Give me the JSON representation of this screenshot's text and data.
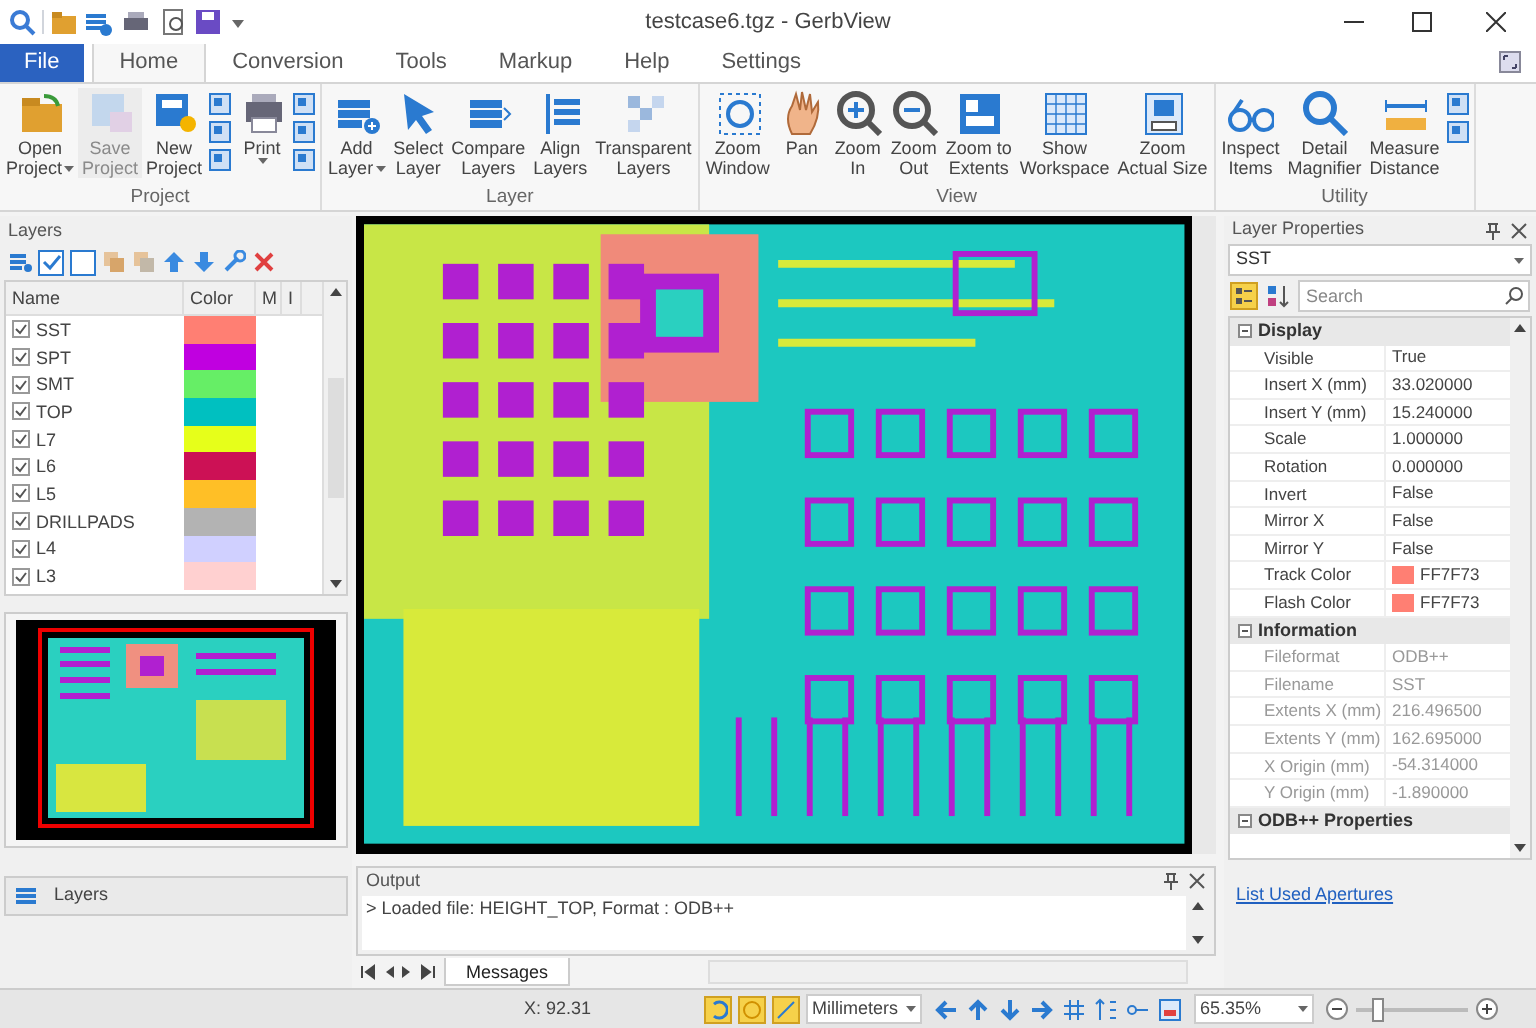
{
  "window": {
    "title": "testcase6.tgz - GerbView"
  },
  "ribbon": {
    "tabs": [
      {
        "label": "File",
        "kind": "file",
        "selected": false
      },
      {
        "label": "Home",
        "kind": "tab",
        "selected": true
      },
      {
        "label": "Conversion",
        "kind": "tab",
        "selected": false
      },
      {
        "label": "Tools",
        "kind": "tab",
        "selected": false
      },
      {
        "label": "Markup",
        "kind": "tab",
        "selected": false
      },
      {
        "label": "Help",
        "kind": "tab",
        "selected": false
      },
      {
        "label": "Settings",
        "kind": "tab",
        "selected": false
      }
    ],
    "groups": [
      {
        "label": "Project",
        "buttons": [
          {
            "lines": [
              "Open",
              "Project"
            ],
            "dropdown": true,
            "disabled": false
          },
          {
            "lines": [
              "Save",
              "Project"
            ],
            "dropdown": false,
            "disabled": true
          },
          {
            "lines": [
              "New",
              "Project"
            ],
            "dropdown": false,
            "disabled": false
          },
          {
            "lines": [
              "Print"
            ],
            "dropdown": true,
            "disabled": false
          }
        ]
      },
      {
        "label": "Layer",
        "buttons": [
          {
            "lines": [
              "Add",
              "Layer"
            ],
            "dropdown": true,
            "disabled": false
          },
          {
            "lines": [
              "Select",
              "Layer"
            ],
            "dropdown": false,
            "disabled": false
          },
          {
            "lines": [
              "Compare",
              "Layers"
            ],
            "dropdown": false,
            "disabled": false
          },
          {
            "lines": [
              "Align",
              "Layers"
            ],
            "dropdown": false,
            "disabled": false
          },
          {
            "lines": [
              "Transparent",
              "Layers"
            ],
            "dropdown": false,
            "disabled": false
          }
        ]
      },
      {
        "label": "View",
        "buttons": [
          {
            "lines": [
              "Zoom",
              "Window"
            ],
            "dropdown": false,
            "disabled": false
          },
          {
            "lines": [
              "Pan"
            ],
            "dropdown": false,
            "disabled": false
          },
          {
            "lines": [
              "Zoom",
              "In"
            ],
            "dropdown": false,
            "disabled": false
          },
          {
            "lines": [
              "Zoom",
              "Out"
            ],
            "dropdown": false,
            "disabled": false
          },
          {
            "lines": [
              "Zoom to",
              "Extents"
            ],
            "dropdown": false,
            "disabled": false
          },
          {
            "lines": [
              "Show",
              "Workspace"
            ],
            "dropdown": false,
            "disabled": false
          },
          {
            "lines": [
              "Zoom",
              "Actual Size"
            ],
            "dropdown": false,
            "disabled": false
          }
        ]
      },
      {
        "label": "Utility",
        "buttons": [
          {
            "lines": [
              "Inspect",
              "Items"
            ],
            "dropdown": false,
            "disabled": false
          },
          {
            "lines": [
              "Detail",
              "Magnifier"
            ],
            "dropdown": false,
            "disabled": false
          },
          {
            "lines": [
              "Measure",
              "Distance"
            ],
            "dropdown": false,
            "disabled": false
          }
        ]
      }
    ]
  },
  "layers_panel": {
    "title": "Layers",
    "columns": [
      "Name",
      "Color",
      "M",
      "I"
    ],
    "rows": [
      {
        "name": "SST",
        "checked": true,
        "color": "#ff7f73"
      },
      {
        "name": "SPT",
        "checked": true,
        "color": "#c000e0"
      },
      {
        "name": "SMT",
        "checked": true,
        "color": "#66ee66"
      },
      {
        "name": "TOP",
        "checked": true,
        "color": "#00c0c0"
      },
      {
        "name": "L7",
        "checked": true,
        "color": "#e6ff1a"
      },
      {
        "name": "L6",
        "checked": true,
        "color": "#cc1155"
      },
      {
        "name": "L5",
        "checked": true,
        "color": "#ffbf26"
      },
      {
        "name": "DRILLPADS",
        "checked": true,
        "color": "#b3b3b3"
      },
      {
        "name": "L4",
        "checked": true,
        "color": "#d0d0ff"
      },
      {
        "name": "L3",
        "checked": true,
        "color": "#ffd0d0"
      }
    ],
    "tab": "Layers"
  },
  "output": {
    "title": "Output",
    "lines": [
      "> Loaded file: HEIGHT_TOP, Format : ODB++"
    ],
    "tabs": [
      {
        "label": "Messages",
        "selected": true
      }
    ]
  },
  "properties": {
    "title": "Layer Properties",
    "layer": "SST",
    "search": {
      "placeholder": "Search"
    },
    "categories": [
      {
        "name": "Display",
        "expanded": true,
        "rows": [
          {
            "label": "Visible",
            "value": "True",
            "readonly": false
          },
          {
            "label": "Insert X (mm)",
            "value": "33.020000",
            "readonly": false
          },
          {
            "label": "Insert Y (mm)",
            "value": "15.240000",
            "readonly": false
          },
          {
            "label": "Scale",
            "value": "1.000000",
            "readonly": false
          },
          {
            "label": "Rotation",
            "value": "0.000000",
            "readonly": false
          },
          {
            "label": "Invert",
            "value": "False",
            "readonly": false
          },
          {
            "label": "Mirror X",
            "value": "False",
            "readonly": false
          },
          {
            "label": "Mirror Y",
            "value": "False",
            "readonly": false
          },
          {
            "label": "Track Color",
            "value": "FF7F73",
            "color": "#ff7f73",
            "readonly": false
          },
          {
            "label": "Flash Color",
            "value": "FF7F73",
            "color": "#ff7f73",
            "readonly": false
          }
        ]
      },
      {
        "name": "Information",
        "expanded": true,
        "rows": [
          {
            "label": "Fileformat",
            "value": "ODB++",
            "readonly": true
          },
          {
            "label": "Filename",
            "value": "SST",
            "readonly": true
          },
          {
            "label": "Extents X (mm)",
            "value": "216.496500",
            "readonly": true
          },
          {
            "label": "Extents Y (mm)",
            "value": "162.695000",
            "readonly": true
          },
          {
            "label": "X Origin (mm)",
            "value": "-54.314000",
            "readonly": true
          },
          {
            "label": "Y Origin (mm)",
            "value": "-1.890000",
            "readonly": true
          }
        ]
      },
      {
        "name": "ODB++ Properties",
        "expanded": true
      }
    ],
    "link": "List Used Apertures"
  },
  "status_bar": {
    "coordinate": "X: 92.31",
    "units": "Millimeters",
    "zoom": "65.35%",
    "zoom_slider": {
      "level": 0.15
    }
  }
}
